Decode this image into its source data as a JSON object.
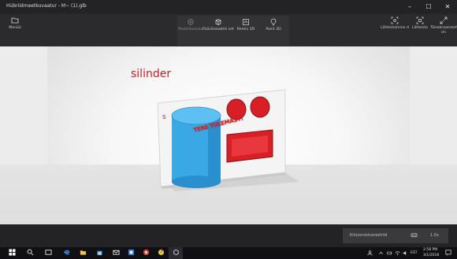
{
  "window": {
    "title": "Hübriidmeetkuvaatur - M~ (1).glb",
    "minimize_glyph": "–",
    "maximize_glyph": "☐",
    "close_glyph": "✕"
  },
  "toolbar": {
    "menu": {
      "label": "Menüü",
      "icon": "folder-icon"
    },
    "tools": [
      {
        "label": "Mudelikaaslus",
        "icon": "sparkle-icon",
        "enabled": false
      },
      {
        "label": "Füüsiliseadmi set",
        "icon": "cube-icon",
        "enabled": true
      },
      {
        "label": "Remix 3D",
        "icon": "remix-icon",
        "enabled": true
      },
      {
        "label": "Paint 3D",
        "icon": "paint-icon",
        "enabled": true
      }
    ],
    "right": [
      {
        "label": "Lähtestamine d",
        "icon": "reset-view-icon"
      },
      {
        "label": "Lähtesta",
        "icon": "reset-icon"
      },
      {
        "label": "Täisekraanrezh im",
        "icon": "fullscreen-icon"
      }
    ]
  },
  "scene": {
    "label_cylinder": "silinder",
    "label_s": "s",
    "label_sticker": "TERE TULEMAST!",
    "colors": {
      "red": "#d91f26",
      "cylinder": "#39a8e5",
      "cylinder_shade": "#1f7fbf",
      "board": "#f4f4f4"
    }
  },
  "status": {
    "label": "Kiirjoonistusrezhiid",
    "zoom": "1.0x"
  },
  "taskbar": {
    "time": "2:58 PM",
    "date": "3/1/2018",
    "lang": "EST",
    "apps": [
      "start-icon",
      "search-icon",
      "task-view-icon",
      "edge-icon",
      "file-explorer-icon",
      "store-icon",
      "mail-icon",
      "app-icon",
      "photos-icon",
      "chrome-icon",
      "mixed-reality-icon"
    ]
  }
}
